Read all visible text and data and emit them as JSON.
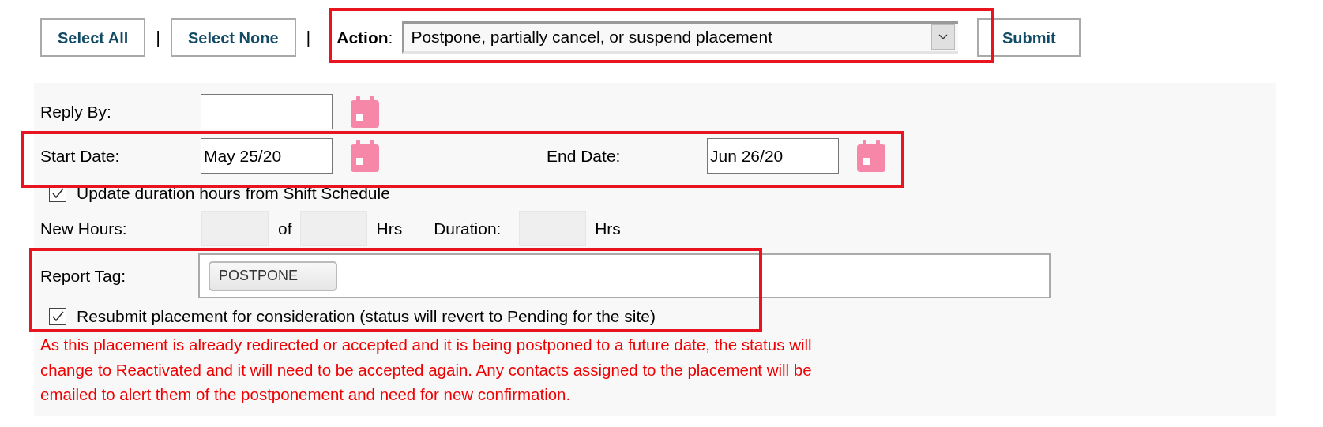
{
  "toolbar": {
    "buttons": [
      "Select All",
      "Select None"
    ],
    "separator": "|",
    "action": {
      "label": "Action",
      "colon": ":",
      "value": "Postpone, partially cancel, or suspend placement",
      "highlighted": true
    },
    "submit": "Submit"
  },
  "form": {
    "reply_by": {
      "label": "Reply By:"
    },
    "dates": {
      "highlighted": true,
      "start": {
        "label": "Start Date:",
        "value": "May 25/20"
      },
      "end": {
        "label": "End Date:",
        "value": "Jun 26/20"
      }
    },
    "update_hours": {
      "label": "Update duration hours from Shift Schedule",
      "checked": true
    },
    "hours": {
      "label": "New Hours:",
      "of": "of",
      "hrs": "Hrs",
      "duration_label": "Duration:",
      "duration_hrs": "Hrs"
    },
    "report": {
      "highlighted": true,
      "label": "Report Tag:",
      "tags": [
        "POSTPONE"
      ],
      "resubmit": {
        "label": "Resubmit placement for consideration (status will revert to Pending for the site)",
        "checked": true
      }
    },
    "warning": "As this placement is already redirected or accepted and it is being postponed to a future date, the status will change to Reactivated and it will need to be accepted again. Any contacts assigned to the placement will be emailed to alert them of the postponement and need for new confirmation."
  }
}
